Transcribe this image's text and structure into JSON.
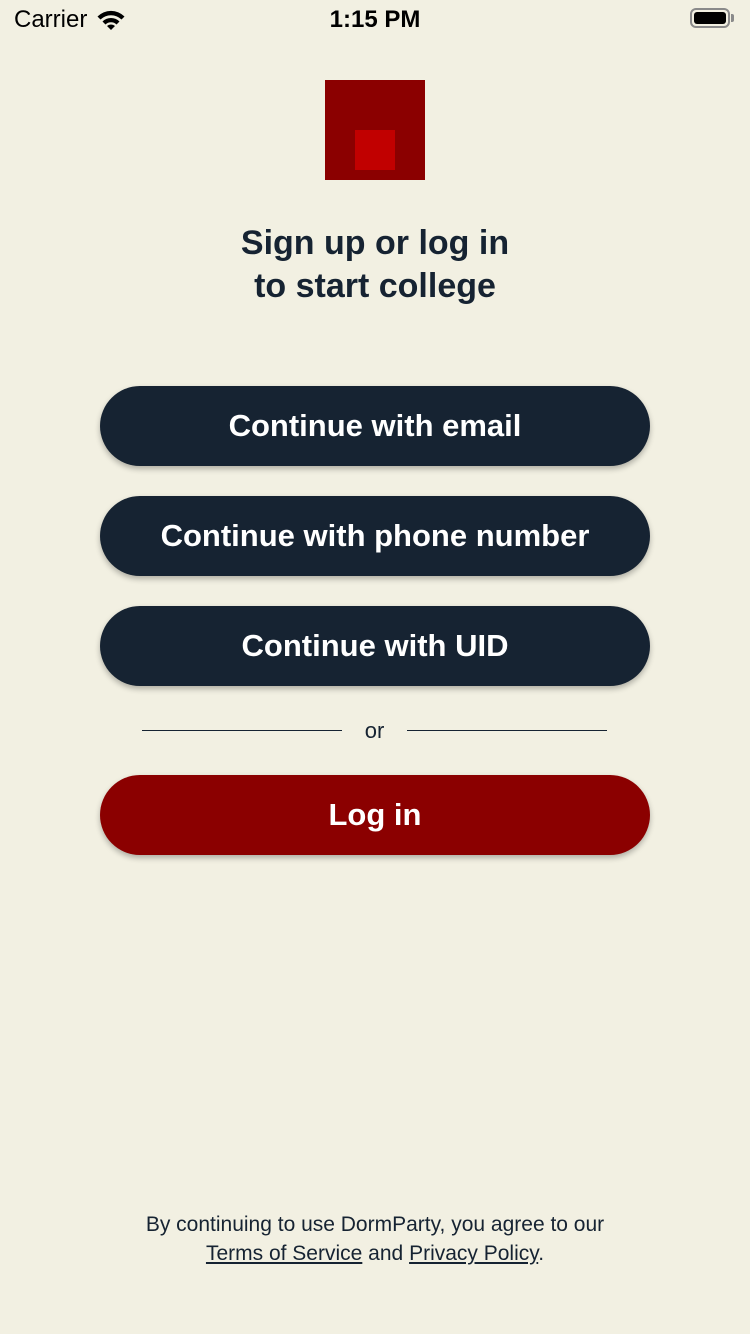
{
  "status_bar": {
    "carrier": "Carrier",
    "time": "1:15 PM"
  },
  "colors": {
    "background": "#F2F0E2",
    "primary_button": "#162332",
    "login_button": "#8B0000",
    "logo_outer": "#8B0000",
    "logo_inner": "#C10000",
    "text": "#162332"
  },
  "headline": {
    "line1": "Sign up or log in",
    "line2": "to start college"
  },
  "buttons": {
    "email": "Continue with email",
    "phone": "Continue with phone number",
    "uid": "Continue with UID",
    "login": "Log in"
  },
  "divider": {
    "text": "or"
  },
  "legal": {
    "prefix": "By continuing to use DormParty, you agree to our",
    "terms": "Terms of Service",
    "and": "and",
    "privacy": "Privacy Policy",
    "suffix": "."
  }
}
